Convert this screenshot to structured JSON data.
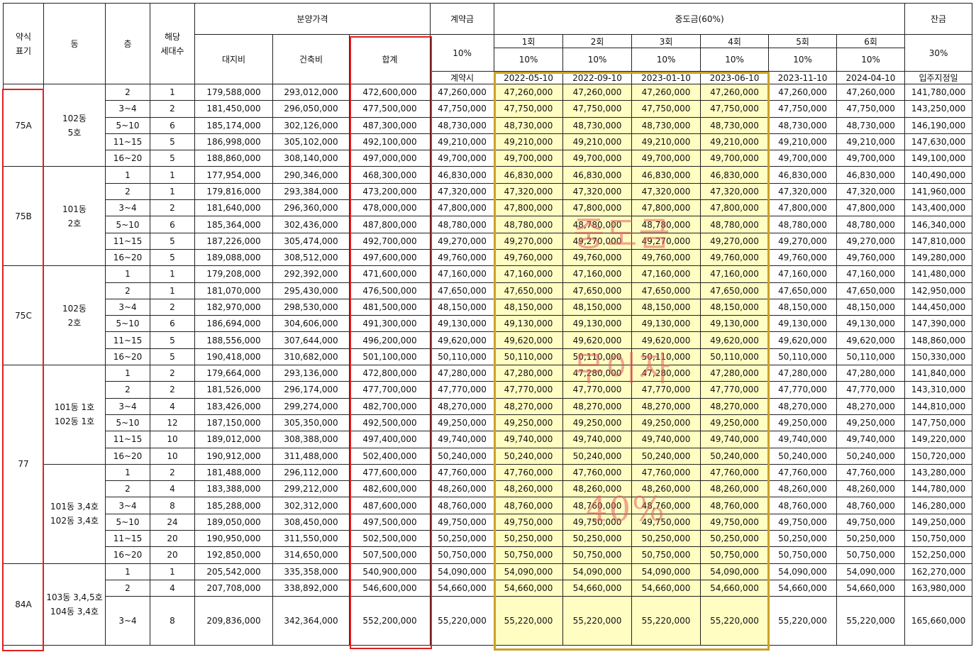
{
  "header": {
    "type_label": "약식\n표기",
    "dong_label": "동",
    "floor_label": "층",
    "units_label": "해당\n세대수",
    "price_label": "분양가격",
    "land_label": "대지비",
    "build_label": "건축비",
    "total_label": "합계",
    "deposit_label": "계약금",
    "deposit_pct": "10%",
    "deposit_when": "계약시",
    "mid_label": "중도금(60%)",
    "mid_rounds": [
      "1회",
      "2회",
      "3회",
      "4회",
      "5회",
      "6회"
    ],
    "mid_pct": [
      "10%",
      "10%",
      "10%",
      "10%",
      "10%",
      "10%"
    ],
    "mid_dates": [
      "2022-05-10",
      "2022-09-10",
      "2023-01-10",
      "2023-06-10",
      "2023-11-10",
      "2024-04-10"
    ],
    "balance_label": "잔금",
    "balance_pct": "30%",
    "balance_when": "입주지정일"
  },
  "groups": [
    {
      "type": "75A",
      "dong": "102동\n5호",
      "rows": [
        [
          "2",
          "1",
          "179,588,000",
          "293,012,000",
          "472,600,000",
          "47,260,000",
          "47,260,000",
          "141,780,000"
        ],
        [
          "3~4",
          "2",
          "181,450,000",
          "296,050,000",
          "477,500,000",
          "47,750,000",
          "47,750,000",
          "143,250,000"
        ],
        [
          "5~10",
          "6",
          "185,174,000",
          "302,126,000",
          "487,300,000",
          "48,730,000",
          "48,730,000",
          "146,190,000"
        ],
        [
          "11~15",
          "5",
          "186,998,000",
          "305,102,000",
          "492,100,000",
          "49,210,000",
          "49,210,000",
          "147,630,000"
        ],
        [
          "16~20",
          "5",
          "188,860,000",
          "308,140,000",
          "497,000,000",
          "49,700,000",
          "49,700,000",
          "149,100,000"
        ]
      ]
    },
    {
      "type": "75B",
      "dong": "101동\n2호",
      "rows": [
        [
          "1",
          "1",
          "177,954,000",
          "290,346,000",
          "468,300,000",
          "46,830,000",
          "46,830,000",
          "140,490,000"
        ],
        [
          "2",
          "1",
          "179,816,000",
          "293,384,000",
          "473,200,000",
          "47,320,000",
          "47,320,000",
          "141,960,000"
        ],
        [
          "3~4",
          "2",
          "181,640,000",
          "296,360,000",
          "478,000,000",
          "47,800,000",
          "47,800,000",
          "143,400,000"
        ],
        [
          "5~10",
          "6",
          "185,364,000",
          "302,436,000",
          "487,800,000",
          "48,780,000",
          "48,780,000",
          "146,340,000"
        ],
        [
          "11~15",
          "5",
          "187,226,000",
          "305,474,000",
          "492,700,000",
          "49,270,000",
          "49,270,000",
          "147,810,000"
        ],
        [
          "16~20",
          "5",
          "189,088,000",
          "308,512,000",
          "497,600,000",
          "49,760,000",
          "49,760,000",
          "149,280,000"
        ]
      ]
    },
    {
      "type": "75C",
      "dong": "102동\n2호",
      "rows": [
        [
          "1",
          "1",
          "179,208,000",
          "292,392,000",
          "471,600,000",
          "47,160,000",
          "47,160,000",
          "141,480,000"
        ],
        [
          "2",
          "1",
          "181,070,000",
          "295,430,000",
          "476,500,000",
          "47,650,000",
          "47,650,000",
          "142,950,000"
        ],
        [
          "3~4",
          "2",
          "182,970,000",
          "298,530,000",
          "481,500,000",
          "48,150,000",
          "48,150,000",
          "144,450,000"
        ],
        [
          "5~10",
          "6",
          "186,694,000",
          "304,606,000",
          "491,300,000",
          "49,130,000",
          "49,130,000",
          "147,390,000"
        ],
        [
          "11~15",
          "5",
          "188,556,000",
          "307,644,000",
          "496,200,000",
          "49,620,000",
          "49,620,000",
          "148,860,000"
        ],
        [
          "16~20",
          "5",
          "190,418,000",
          "310,682,000",
          "501,100,000",
          "50,110,000",
          "50,110,000",
          "150,330,000"
        ]
      ]
    },
    {
      "type": "77",
      "dong": "101동 1호\n102동 1호",
      "rows": [
        [
          "1",
          "2",
          "179,664,000",
          "293,136,000",
          "472,800,000",
          "47,280,000",
          "47,280,000",
          "141,840,000"
        ],
        [
          "2",
          "2",
          "181,526,000",
          "296,174,000",
          "477,700,000",
          "47,770,000",
          "47,770,000",
          "143,310,000"
        ],
        [
          "3~4",
          "4",
          "183,426,000",
          "299,274,000",
          "482,700,000",
          "48,270,000",
          "48,270,000",
          "144,810,000"
        ],
        [
          "5~10",
          "12",
          "187,150,000",
          "305,350,000",
          "492,500,000",
          "49,250,000",
          "49,250,000",
          "147,750,000"
        ],
        [
          "11~15",
          "10",
          "189,012,000",
          "308,388,000",
          "497,400,000",
          "49,740,000",
          "49,740,000",
          "149,220,000"
        ],
        [
          "16~20",
          "10",
          "190,912,000",
          "311,488,000",
          "502,400,000",
          "50,240,000",
          "50,240,000",
          "150,720,000"
        ]
      ]
    },
    {
      "type": "",
      "dong": "101동 3,4호\n102동 3,4호",
      "rows": [
        [
          "1",
          "2",
          "181,488,000",
          "296,112,000",
          "477,600,000",
          "47,760,000",
          "47,760,000",
          "143,280,000"
        ],
        [
          "2",
          "4",
          "183,388,000",
          "299,212,000",
          "482,600,000",
          "48,260,000",
          "48,260,000",
          "144,780,000"
        ],
        [
          "3~4",
          "8",
          "185,288,000",
          "302,312,000",
          "487,600,000",
          "48,760,000",
          "48,760,000",
          "146,280,000"
        ],
        [
          "5~10",
          "24",
          "189,050,000",
          "308,450,000",
          "497,500,000",
          "49,750,000",
          "49,750,000",
          "149,250,000"
        ],
        [
          "11~15",
          "20",
          "190,950,000",
          "311,550,000",
          "502,500,000",
          "50,250,000",
          "50,250,000",
          "150,750,000"
        ],
        [
          "16~20",
          "20",
          "192,850,000",
          "314,650,000",
          "507,500,000",
          "50,750,000",
          "50,750,000",
          "152,250,000"
        ]
      ]
    },
    {
      "type": "84A",
      "dong": "103동 3,4,5호\n104동 3,4호",
      "rows": [
        [
          "1",
          "1",
          "205,542,000",
          "335,358,000",
          "540,900,000",
          "54,090,000",
          "54,090,000",
          "162,270,000"
        ],
        [
          "2",
          "4",
          "207,708,000",
          "338,892,000",
          "546,600,000",
          "54,660,000",
          "54,660,000",
          "163,980,000"
        ],
        [
          "3~4",
          "8",
          "209,836,000",
          "342,364,000",
          "552,200,000",
          "55,220,000",
          "55,220,000",
          "165,660,000"
        ]
      ]
    }
  ],
  "watermarks": [
    "중도금",
    "무이자",
    "40%"
  ],
  "colors": {
    "mid_highlight": "#fffdc2",
    "red_outline": "#e02020",
    "gold_outline": "#c9a227",
    "watermark": "#e15f5f"
  }
}
